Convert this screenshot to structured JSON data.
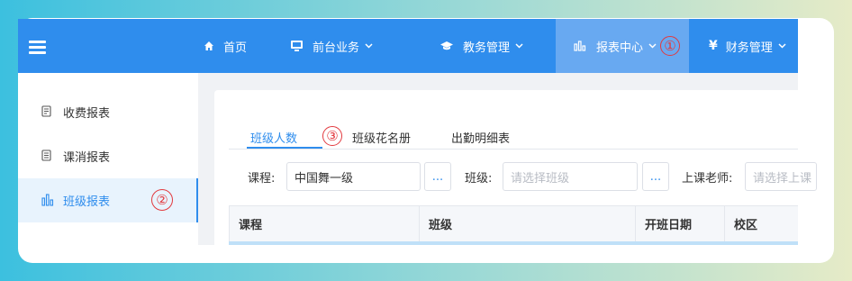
{
  "topnav": {
    "items": [
      {
        "label": "首页",
        "icon": "home-icon",
        "dropdown": false
      },
      {
        "label": "前台业务",
        "icon": "monitor-icon",
        "dropdown": true
      },
      {
        "label": "教务管理",
        "icon": "graduation-cap-icon",
        "dropdown": true
      },
      {
        "label": "报表中心",
        "icon": "bar-chart-icon",
        "dropdown": true,
        "active": true
      },
      {
        "label": "财务管理",
        "icon": "yen-icon",
        "dropdown": true
      }
    ]
  },
  "sidebar": {
    "items": [
      {
        "label": "收费报表",
        "icon": "receipt-icon"
      },
      {
        "label": "课消报表",
        "icon": "document-icon"
      },
      {
        "label": "班级报表",
        "icon": "bar-chart-icon",
        "active": true
      }
    ]
  },
  "tabs": [
    {
      "label": "班级人数",
      "active": true
    },
    {
      "label": "班级花名册"
    },
    {
      "label": "出勤明细表"
    }
  ],
  "filters": {
    "course_label": "课程:",
    "course_value": "中国舞一级",
    "class_label": "班级:",
    "class_placeholder": "请选择班级",
    "teacher_label": "上课老师:",
    "teacher_placeholder": "请选择上课",
    "dots": "..."
  },
  "table": {
    "headers": [
      "课程",
      "班级",
      "开班日期",
      "校区"
    ]
  },
  "annotations": [
    "①",
    "②",
    "③"
  ],
  "colors": {
    "primary": "#2f8ded",
    "active_nav": "#68a9f1",
    "annotation": "#e2393e"
  }
}
